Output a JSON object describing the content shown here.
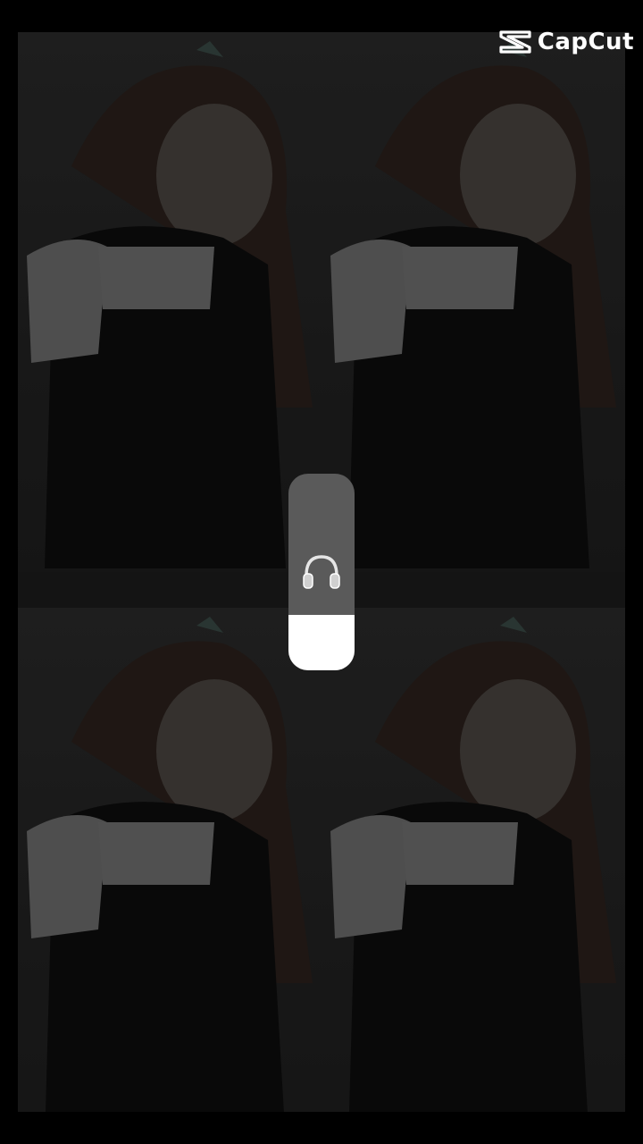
{
  "watermark": {
    "brand": "CapCut",
    "logo_icon": "capcut-logo-icon"
  },
  "video": {
    "layout": "2x2-grid",
    "tiles": [
      "top-left",
      "top-right",
      "bottom-left",
      "bottom-right"
    ]
  },
  "volume_hud": {
    "icon": "headphones-icon",
    "level": 0.28
  },
  "colors": {
    "background": "#000000",
    "hud_track": "#5a5a5a",
    "hud_fill": "#ffffff"
  }
}
